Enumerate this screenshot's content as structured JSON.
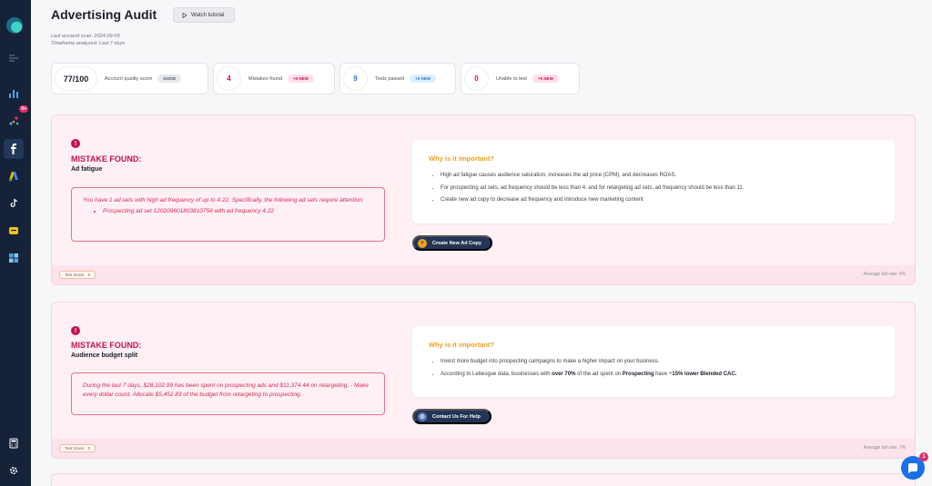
{
  "header": {
    "title": "Advertising Audit",
    "tutorial_label": "Watch tutorial",
    "last_scan": "Last account scan: 2024-09-09",
    "timeframe": "Timeframe analyzed: Last 7 days"
  },
  "sidebar": {
    "badge": "9+"
  },
  "stats": [
    {
      "value": "77/100",
      "label": "Account quality score",
      "badge": "GOOD"
    },
    {
      "value": "4",
      "label": "Mistakes found",
      "badge": "+0 NEW"
    },
    {
      "value": "9",
      "label": "Tests passed",
      "badge": "+0 NEW"
    },
    {
      "value": "0",
      "label": "Unable to test",
      "badge": "+0 NEW"
    }
  ],
  "cards": [
    {
      "icon": "!",
      "mistake_label": "MISTAKE FOUND:",
      "name": "Ad fatigue",
      "message": "You have 1 ad sets with high ad frequency of up to 4.22. Specifically, the following ad sets require attention:",
      "message_item": "Prospecting ad set 120209601803810756 with ad frequency 4.22",
      "why_title": "Why is it important?",
      "why_items": [
        "High ad fatigue causes audience saturation, increases the ad price (CPM), and decreases ROAS.",
        "For prospecting ad sets, ad frequency should be less than 4, and for retargeting ad sets, ad frequency should be less than 11.",
        "Create new ad copy to decrease ad frequency and introduce new marketing content"
      ],
      "action_label": "Create New Ad Copy",
      "test_score_label": "Test Score",
      "test_score_value": "5",
      "fail_rate": "Average fail rate: 4%"
    },
    {
      "icon": "!",
      "mistake_label": "MISTAKE FOUND:",
      "name": "Audience budget split",
      "message": "During the last 7 days, $28,102.99 has been spent on prospecting ads and $11,374.44 on retargeting. - Make every dollar count. Allocate $5,452.83 of the budget from retargeting to prospecting.",
      "why_title": "Why is it important?",
      "why_item_1": "Invest more budget into prospecting campaigns to make a higher impact on your business.",
      "why_item_2": {
        "pre": "According to Lebesgue data, businesses with ",
        "bold1": "over 70%",
        "mid": " of the ad spent on ",
        "bold2": "Prospecting",
        "mid2": " have ",
        "bold3": "~15% lower Blended CAC."
      },
      "action_label": "Contact Us For Help",
      "test_score_label": "Test Score",
      "test_score_value": "5",
      "fail_rate": "Average fail rate: 7%"
    }
  ],
  "chat": {
    "badge": "1"
  },
  "colors": {
    "sidebar": "#152238",
    "accent_red": "#c4124f",
    "accent_orange": "#f0a01d",
    "button_navy": "#233456"
  }
}
